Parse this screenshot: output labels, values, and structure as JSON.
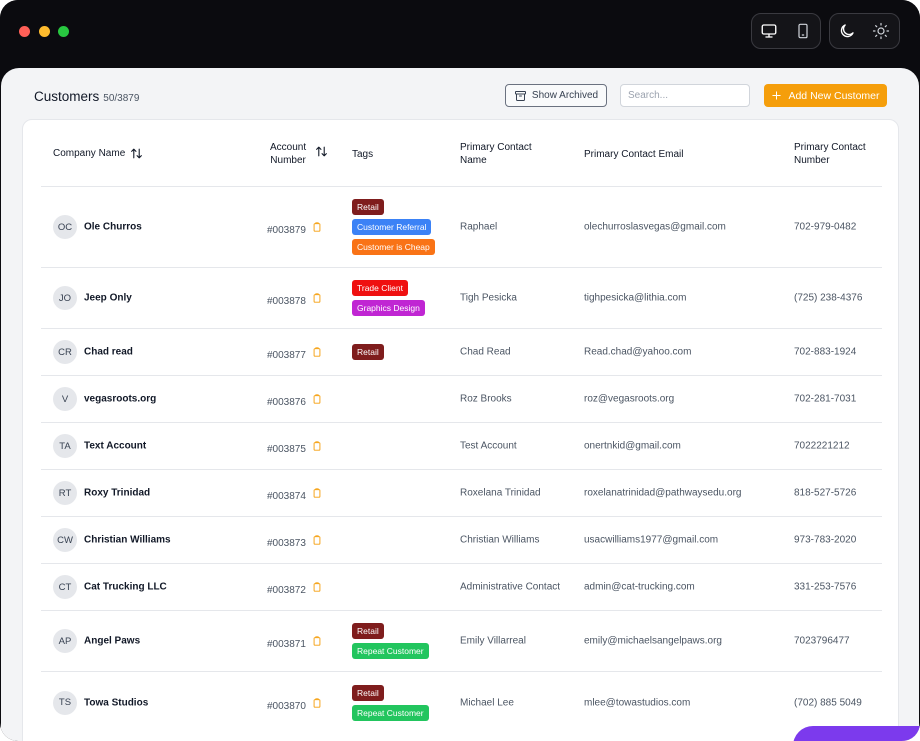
{
  "window": {
    "controls": [
      "close",
      "minimize",
      "maximize"
    ]
  },
  "toolbar": {
    "device_icons": [
      "desktop-icon",
      "phone-icon"
    ],
    "theme_icons": [
      "moon-icon",
      "sun-icon"
    ]
  },
  "page": {
    "title": "Customers",
    "count": "50/3879",
    "show_archived_label": "Show Archived",
    "search_placeholder": "Search...",
    "add_button_label": "Add New Customer"
  },
  "table": {
    "columns": {
      "company": "Company Name",
      "account_line1": "Account",
      "account_line2": "Number",
      "tags": "Tags",
      "contact_name_line1": "Primary Contact",
      "contact_name_line2": "Name",
      "contact_email": "Primary Contact Email",
      "contact_number_line1": "Primary Contact",
      "contact_number_line2": "Number"
    },
    "rows": [
      {
        "initials": "OC",
        "company": "Ole Churros",
        "account": "#003879",
        "tags": [
          {
            "label": "Retail",
            "color": "#7f1d1d"
          },
          {
            "label": "Customer Referral",
            "color": "#3b82f6"
          },
          {
            "label": "Customer is Cheap",
            "color": "#f97316"
          }
        ],
        "contact_name": "Raphael",
        "email": "olechurroslasvegas@gmail.com",
        "phone": "702-979-0482"
      },
      {
        "initials": "JO",
        "company": "Jeep Only",
        "account": "#003878",
        "tags": [
          {
            "label": "Trade Client",
            "color": "#ef1010"
          },
          {
            "label": "Graphics Design",
            "color": "#c026d3"
          }
        ],
        "contact_name": "Tigh Pesicka",
        "email": "tighpesicka@lithia.com",
        "phone": "(725) 238-4376"
      },
      {
        "initials": "CR",
        "company": "Chad read",
        "account": "#003877",
        "tags": [
          {
            "label": "Retail",
            "color": "#7f1d1d"
          }
        ],
        "contact_name": "Chad Read",
        "email": "Read.chad@yahoo.com",
        "phone": "702-883-1924"
      },
      {
        "initials": "V",
        "company": "vegasroots.org",
        "account": "#003876",
        "tags": [],
        "contact_name": "Roz Brooks",
        "email": "roz@vegasroots.org",
        "phone": "702-281-7031"
      },
      {
        "initials": "TA",
        "company": "Text Account",
        "account": "#003875",
        "tags": [],
        "contact_name": "Test Account",
        "email": "onertnkid@gmail.com",
        "phone": "7022221212"
      },
      {
        "initials": "RT",
        "company": "Roxy Trinidad",
        "account": "#003874",
        "tags": [],
        "contact_name": "Roxelana Trinidad",
        "email": "roxelanatrinidad@pathwaysedu.org",
        "phone": "818-527-5726"
      },
      {
        "initials": "CW",
        "company": "Christian Williams",
        "account": "#003873",
        "tags": [],
        "contact_name": "Christian Williams",
        "email": "usacwilliams1977@gmail.com",
        "phone": "973-783-2020"
      },
      {
        "initials": "CT",
        "company": "Cat Trucking LLC",
        "account": "#003872",
        "tags": [],
        "contact_name": "Administrative Contact",
        "email": "admin@cat-trucking.com",
        "phone": "331-253-7576"
      },
      {
        "initials": "AP",
        "company": "Angel Paws",
        "account": "#003871",
        "tags": [
          {
            "label": "Retail",
            "color": "#7f1d1d"
          },
          {
            "label": "Repeat Customer",
            "color": "#22c55e"
          }
        ],
        "contact_name": "Emily Villarreal",
        "email": "emily@michaelsangelpaws.org",
        "phone": "7023796477"
      },
      {
        "initials": "TS",
        "company": "Towa Studios",
        "account": "#003870",
        "tags": [
          {
            "label": "Retail",
            "color": "#7f1d1d"
          },
          {
            "label": "Repeat Customer",
            "color": "#22c55e"
          }
        ],
        "contact_name": "Michael Lee",
        "email": "mlee@towastudios.com",
        "phone": "(702) 885 5049"
      }
    ]
  },
  "colors": {
    "accent": "#f59e0b",
    "titlebar": "#0b0b0f",
    "background": "#f3f4f6",
    "floating_button": "#7c3aed"
  }
}
